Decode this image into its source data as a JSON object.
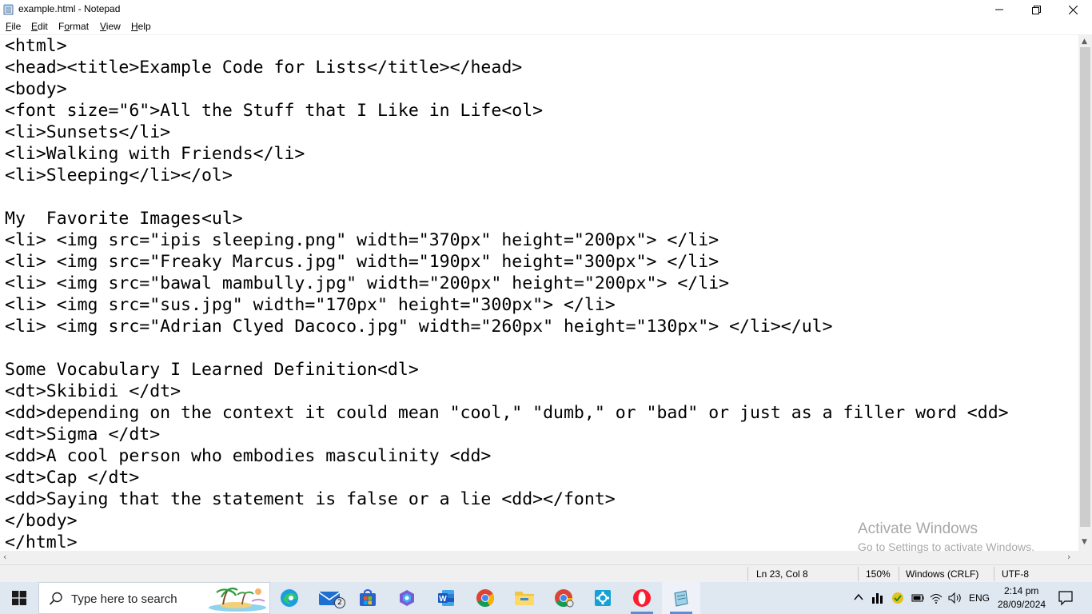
{
  "window": {
    "title": "example.html - Notepad"
  },
  "menu": [
    {
      "acc": "F",
      "rest": "ile"
    },
    {
      "acc": "E",
      "rest": "dit"
    },
    {
      "acc": "",
      "pre": "F",
      "accmid": "o",
      "rest": "rmat"
    },
    {
      "acc": "V",
      "rest": "iew"
    },
    {
      "acc": "H",
      "rest": "elp"
    }
  ],
  "editor": {
    "lines": [
      "<html>",
      "<head><title>Example Code for Lists</title></head>",
      "<body>",
      "<font size=\"6\">All the Stuff that I Like in Life<ol>",
      "<li>Sunsets</li>",
      "<li>Walking with Friends</li>",
      "<li>Sleeping</li></ol>",
      "",
      "My  Favorite Images<ul>",
      "<li> <img src=\"ipis sleeping.png\" width=\"370px\" height=\"200px\"> </li>",
      "<li> <img src=\"Freaky Marcus.jpg\" width=\"190px\" height=\"300px\"> </li>",
      "<li> <img src=\"bawal mambully.jpg\" width=\"200px\" height=\"200px\"> </li>",
      "<li> <img src=\"sus.jpg\" width=\"170px\" height=\"300px\"> </li>",
      "<li> <img src=\"Adrian Clyed Dacoco.jpg\" width=\"260px\" height=\"130px\"> </li></ul>",
      "",
      "Some Vocabulary I Learned Definition<dl>",
      "<dt>Skibidi </dt>",
      "<dd>depending on the context it could mean \"cool,\" \"dumb,\" or \"bad\" or just as a filler word <dd>",
      "<dt>Sigma </dt>",
      "<dd>A cool person who embodies masculinity <dd>",
      "<dt>Cap </dt>",
      "<dd>Saying that the statement is false or a lie <dd></font>",
      "</body>",
      "</html>"
    ]
  },
  "watermark": {
    "line1": "Activate Windows",
    "line2": "Go to Settings to activate Windows."
  },
  "status": {
    "position": "Ln 23, Col 8",
    "zoom": "150%",
    "line_ending": "Windows (CRLF)",
    "encoding": "UTF-8"
  },
  "taskbar": {
    "search_placeholder": "Type here to search",
    "mail_badge": "2",
    "language": "ENG",
    "time": "2:14 pm",
    "date": "28/09/2024"
  }
}
